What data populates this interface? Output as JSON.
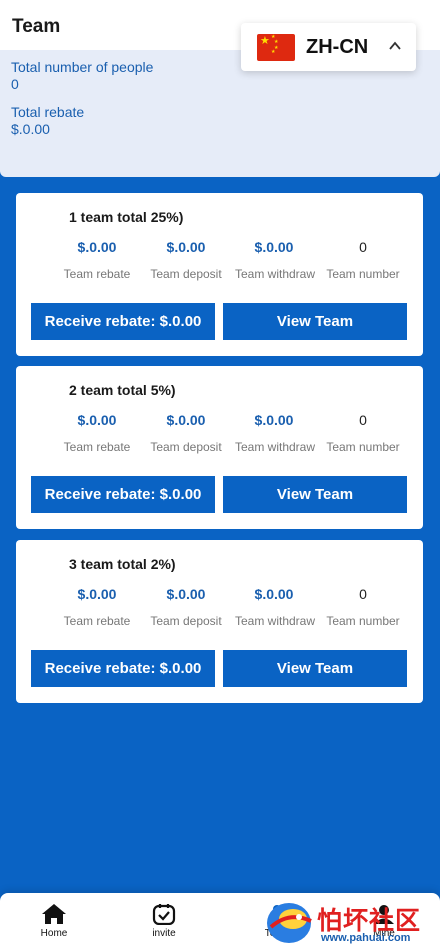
{
  "header": {
    "title": "Team",
    "total_people_label": "Total number of people",
    "total_people_value": "0",
    "total_rebate_label": "Total rebate",
    "total_rebate_value": "$.0.00"
  },
  "language": {
    "label": "ZH-CN",
    "flag_icon": "china-flag-icon",
    "chevron_icon": "chevron-up-icon"
  },
  "cards": [
    {
      "title": "1 team total 25%)",
      "team_rebate": "$.0.00",
      "team_deposit": "$.0.00",
      "team_withdraw": "$.0.00",
      "team_number": "0",
      "receive_button": "Receive rebate: $.0.00",
      "view_button": "View Team"
    },
    {
      "title": "2 team total 5%)",
      "team_rebate": "$.0.00",
      "team_deposit": "$.0.00",
      "team_withdraw": "$.0.00",
      "team_number": "0",
      "receive_button": "Receive rebate: $.0.00",
      "view_button": "View Team"
    },
    {
      "title": "3 team total 2%)",
      "team_rebate": "$.0.00",
      "team_deposit": "$.0.00",
      "team_withdraw": "$.0.00",
      "team_number": "0",
      "receive_button": "Receive rebate: $.0.00",
      "view_button": "View Team"
    }
  ],
  "metric_labels": {
    "team_rebate": "Team rebate",
    "team_deposit": "Team deposit",
    "team_withdraw": "Team withdraw",
    "team_number": "Team number"
  },
  "nav": {
    "items": [
      {
        "label": "Home",
        "icon": "home-icon"
      },
      {
        "label": "invite",
        "icon": "invite-icon"
      },
      {
        "label": "Team",
        "icon": "team-icon"
      },
      {
        "label": "Mine",
        "icon": "mine-icon"
      }
    ]
  },
  "watermark": {
    "text": "怕坏社区",
    "url": "www.pahuai.com"
  },
  "colors": {
    "accent": "#0a63c4",
    "value_blue": "#1a5faf",
    "header_bg": "#e6ecf8"
  }
}
